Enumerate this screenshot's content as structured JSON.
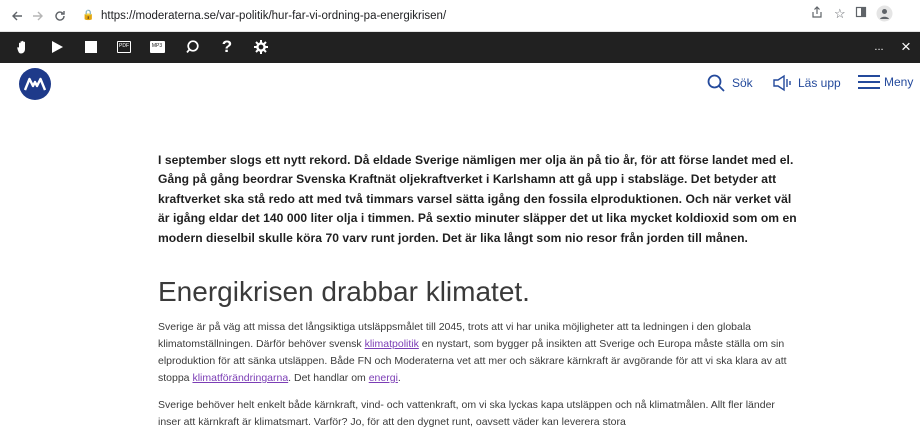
{
  "browser": {
    "url": "https://moderaterna.se/var-politik/hur-far-vi-ordning-pa-energikrisen/",
    "back_icon": "arrow-left-icon",
    "forward_icon": "arrow-right-icon",
    "reload_icon": "reload-icon"
  },
  "toolbar": {
    "buttons": [
      "hand-icon",
      "play-icon",
      "stop-icon",
      "pdf-icon",
      "audio-file-icon",
      "search-icon",
      "help-icon",
      "settings-icon"
    ],
    "more_label": "...",
    "close_label": "×"
  },
  "header": {
    "search_label": "Sök",
    "read_label": "Läs upp",
    "menu_label": "Meny"
  },
  "article": {
    "lead": "I september slogs ett nytt rekord. Då eldade Sverige nämligen mer olja än på tio år, för att förse landet med el. Gång på gång beordrar Svenska Kraftnät oljekraftverket i Karlshamn att gå upp i stabsläge. Det betyder att kraftverket ska stå redo att med två timmars varsel sätta igång den fossila elproduktionen. Och när verket väl är igång eldar det 140 000 liter olja i timmen. På sextio minuter släpper det ut lika mycket koldioxid som om en modern dieselbil skulle köra 70 varv runt jorden. Det är lika långt som nio resor från jorden till månen.",
    "heading": "Energikrisen drabbar klimatet.",
    "p1": {
      "t1": "Sverige är på väg att missa det långsiktiga utsläppsmålet till 2045, trots att vi har unika möjligheter att ta ledningen i den globala klimatomställningen. Därför behöver svensk ",
      "link1": "klimatpolitik",
      "t2": " en nystart, som bygger på insikten att Sverige och Europa måste ställa om sin elproduktion för att sänka utsläppen. Både FN och Moderaterna vet att mer och säkrare kärnkraft är avgörande för att vi ska klara av att stoppa ",
      "link2": "klimatförändringarna",
      "t3": ". Det handlar om ",
      "link3": "energi",
      "t4": "."
    },
    "p2": "Sverige behöver helt enkelt både kärnkraft, vind- och vattenkraft, om vi ska lyckas kapa utsläppen och nå klimatmålen. Allt fler länder inser att kärnkraft är klimatsmart. Varför? Jo, för att den dygnet runt, oavsett väder kan leverera stora"
  }
}
